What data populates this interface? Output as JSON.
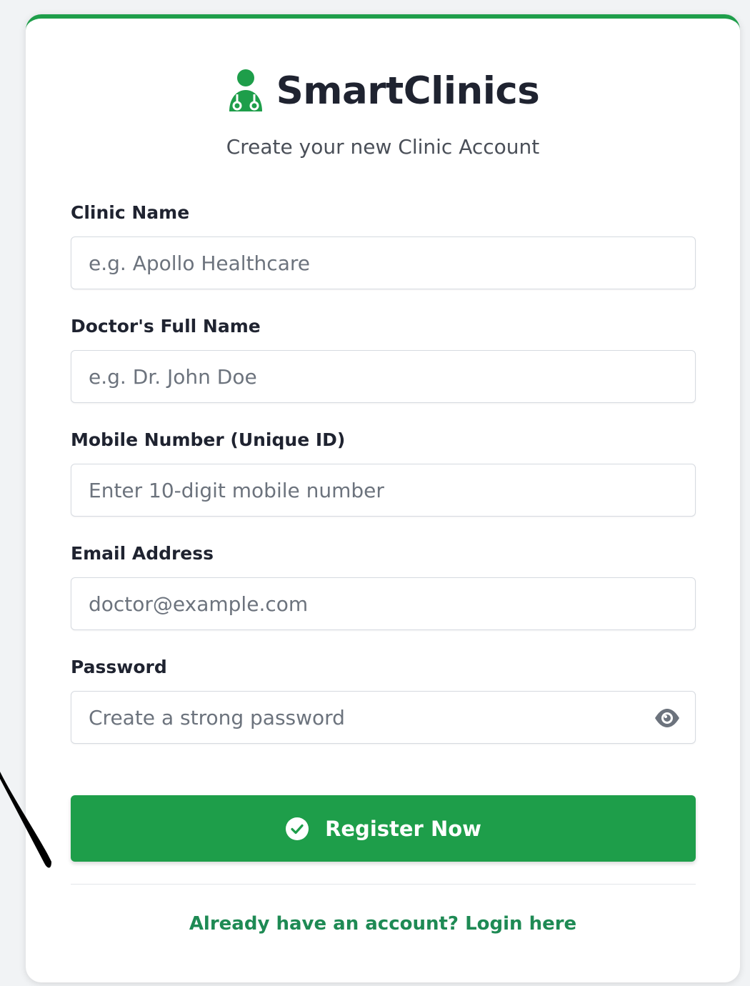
{
  "brand": {
    "name": "SmartClinics",
    "subtitle": "Create your new Clinic Account"
  },
  "form": {
    "fields": [
      {
        "label": "Clinic Name",
        "placeholder": "e.g. Apollo Healthcare",
        "value": ""
      },
      {
        "label": "Doctor's Full Name",
        "placeholder": "e.g. Dr. John Doe",
        "value": ""
      },
      {
        "label": "Mobile Number (Unique ID)",
        "placeholder": "Enter 10-digit mobile number",
        "value": ""
      },
      {
        "label": "Email Address",
        "placeholder": "doctor@example.com",
        "value": ""
      },
      {
        "label": "Password",
        "placeholder": "Create a strong password",
        "value": ""
      }
    ],
    "submit_label": "Register Now",
    "login_link": "Already have an account? Login here"
  },
  "icons": {
    "logo": "user-doctor-icon",
    "password_toggle": "eye-icon",
    "submit": "check-circle-icon"
  },
  "colors": {
    "accent": "#1e9e4a",
    "link": "#1e8a54",
    "text": "#1f2330"
  }
}
